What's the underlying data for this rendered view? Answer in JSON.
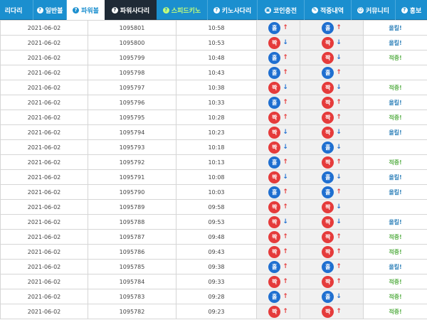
{
  "nav": {
    "tabs": [
      {
        "label": "리다리",
        "icon": "",
        "style": "plain"
      },
      {
        "label": "일반볼",
        "icon": "?",
        "style": "plain"
      },
      {
        "label": "파워볼",
        "icon": "?",
        "style": "active"
      },
      {
        "label": "파워사다리",
        "icon": "?",
        "style": "dark"
      },
      {
        "label": "스피드키노",
        "icon": "?",
        "style": "green"
      },
      {
        "label": "키노사다리",
        "icon": "?",
        "style": "plain"
      },
      {
        "label": "코인충전",
        "icon": "▣",
        "style": "plain"
      },
      {
        "label": "적중내역",
        "icon": "✎",
        "style": "plain"
      },
      {
        "label": "커뮤니티",
        "icon": "☺",
        "style": "plain"
      },
      {
        "label": "홍보",
        "icon": "?",
        "style": "plain"
      }
    ]
  },
  "colors": {
    "nav": "#1b8fcf",
    "odd": "#e53b3b",
    "even": "#1f6fd0",
    "hit": "#5bb04a",
    "miss": "#2c7fb8"
  },
  "rows": [
    {
      "date": "2021-06-02",
      "round": "1095801",
      "time": "10:58",
      "a": "홀",
      "aDir": "up",
      "b": "홀",
      "bDir": "up",
      "result": "올킬!"
    },
    {
      "date": "2021-06-02",
      "round": "1095800",
      "time": "10:53",
      "a": "짝",
      "aDir": "down",
      "b": "짝",
      "bDir": "down",
      "result": "올킬!"
    },
    {
      "date": "2021-06-02",
      "round": "1095799",
      "time": "10:48",
      "a": "홀",
      "aDir": "up",
      "b": "짝",
      "bDir": "down",
      "result": "적중!"
    },
    {
      "date": "2021-06-02",
      "round": "1095798",
      "time": "10:43",
      "a": "홀",
      "aDir": "up",
      "b": "홀",
      "bDir": "up",
      "result": ""
    },
    {
      "date": "2021-06-02",
      "round": "1095797",
      "time": "10:38",
      "a": "짝",
      "aDir": "down",
      "b": "짝",
      "bDir": "down",
      "result": "적중!"
    },
    {
      "date": "2021-06-02",
      "round": "1095796",
      "time": "10:33",
      "a": "홀",
      "aDir": "up",
      "b": "짝",
      "bDir": "up",
      "result": "올킬!"
    },
    {
      "date": "2021-06-02",
      "round": "1095795",
      "time": "10:28",
      "a": "짝",
      "aDir": "up",
      "b": "짝",
      "bDir": "up",
      "result": "적중!"
    },
    {
      "date": "2021-06-02",
      "round": "1095794",
      "time": "10:23",
      "a": "짝",
      "aDir": "down",
      "b": "짝",
      "bDir": "down",
      "result": "올킬!"
    },
    {
      "date": "2021-06-02",
      "round": "1095793",
      "time": "10:18",
      "a": "짝",
      "aDir": "down",
      "b": "홀",
      "bDir": "down",
      "result": ""
    },
    {
      "date": "2021-06-02",
      "round": "1095792",
      "time": "10:13",
      "a": "홀",
      "aDir": "up",
      "b": "짝",
      "bDir": "up",
      "result": "적중!"
    },
    {
      "date": "2021-06-02",
      "round": "1095791",
      "time": "10:08",
      "a": "짝",
      "aDir": "down",
      "b": "홀",
      "bDir": "down",
      "result": "올킬!"
    },
    {
      "date": "2021-06-02",
      "round": "1095790",
      "time": "10:03",
      "a": "홀",
      "aDir": "up",
      "b": "홀",
      "bDir": "up",
      "result": "올킬!"
    },
    {
      "date": "2021-06-02",
      "round": "1095789",
      "time": "09:58",
      "a": "짝",
      "aDir": "up",
      "b": "짝",
      "bDir": "down",
      "result": ""
    },
    {
      "date": "2021-06-02",
      "round": "1095788",
      "time": "09:53",
      "a": "짝",
      "aDir": "down",
      "b": "짝",
      "bDir": "down",
      "result": "올킬!"
    },
    {
      "date": "2021-06-02",
      "round": "1095787",
      "time": "09:48",
      "a": "짝",
      "aDir": "up",
      "b": "짝",
      "bDir": "up",
      "result": "적중!"
    },
    {
      "date": "2021-06-02",
      "round": "1095786",
      "time": "09:43",
      "a": "짝",
      "aDir": "up",
      "b": "짝",
      "bDir": "up",
      "result": "적중!"
    },
    {
      "date": "2021-06-02",
      "round": "1095785",
      "time": "09:38",
      "a": "홀",
      "aDir": "up",
      "b": "홀",
      "bDir": "up",
      "result": "올킬!"
    },
    {
      "date": "2021-06-02",
      "round": "1095784",
      "time": "09:33",
      "a": "짝",
      "aDir": "up",
      "b": "짝",
      "bDir": "up",
      "result": "적중!"
    },
    {
      "date": "2021-06-02",
      "round": "1095783",
      "time": "09:28",
      "a": "홀",
      "aDir": "up",
      "b": "홀",
      "bDir": "down",
      "result": "적중!"
    },
    {
      "date": "2021-06-02",
      "round": "1095782",
      "time": "09:23",
      "a": "짝",
      "aDir": "up",
      "b": "짝",
      "bDir": "up",
      "result": "적중!"
    }
  ]
}
